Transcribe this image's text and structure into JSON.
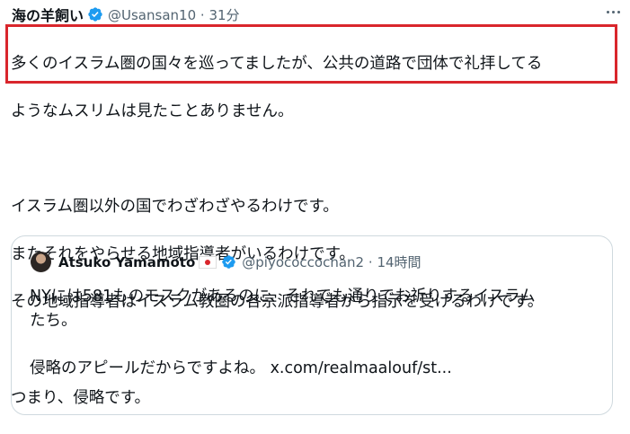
{
  "tweet": {
    "display_name": "海の羊飼い",
    "handle": "@Usansan10",
    "time": "31分",
    "highlighted_text": [
      "多くのイスラム圏の国々を巡ってましたが、公共の道路で団体で礼拝してる",
      "ようなムスリムは見たことありません。"
    ],
    "paragraph2": [
      "イスラム圏以外の国でわざわざやるわけです。",
      "またそれをやらせる地域指導者がいるわけです。",
      "その地域指導者はイスラム教圏の各宗派指導者から指示を受けるわけです。"
    ],
    "paragraph3": "つまり、侵略です。",
    "colors": {
      "highlight_border": "#d9262c",
      "verified": "#1d9bf0"
    }
  },
  "quote": {
    "display_name": "Atsuko Yamamoto",
    "flag": "japan-flag",
    "handle": "@piyococcochan2",
    "time": "14時間",
    "text_lines": [
      "NYには581ものモスクがあるのに、それでも通りでお祈りするイスラム",
      "たち。"
    ],
    "last_line_text": "侵略のアピールだからですよね。",
    "link": "x.com/realmaalouf/st..."
  }
}
